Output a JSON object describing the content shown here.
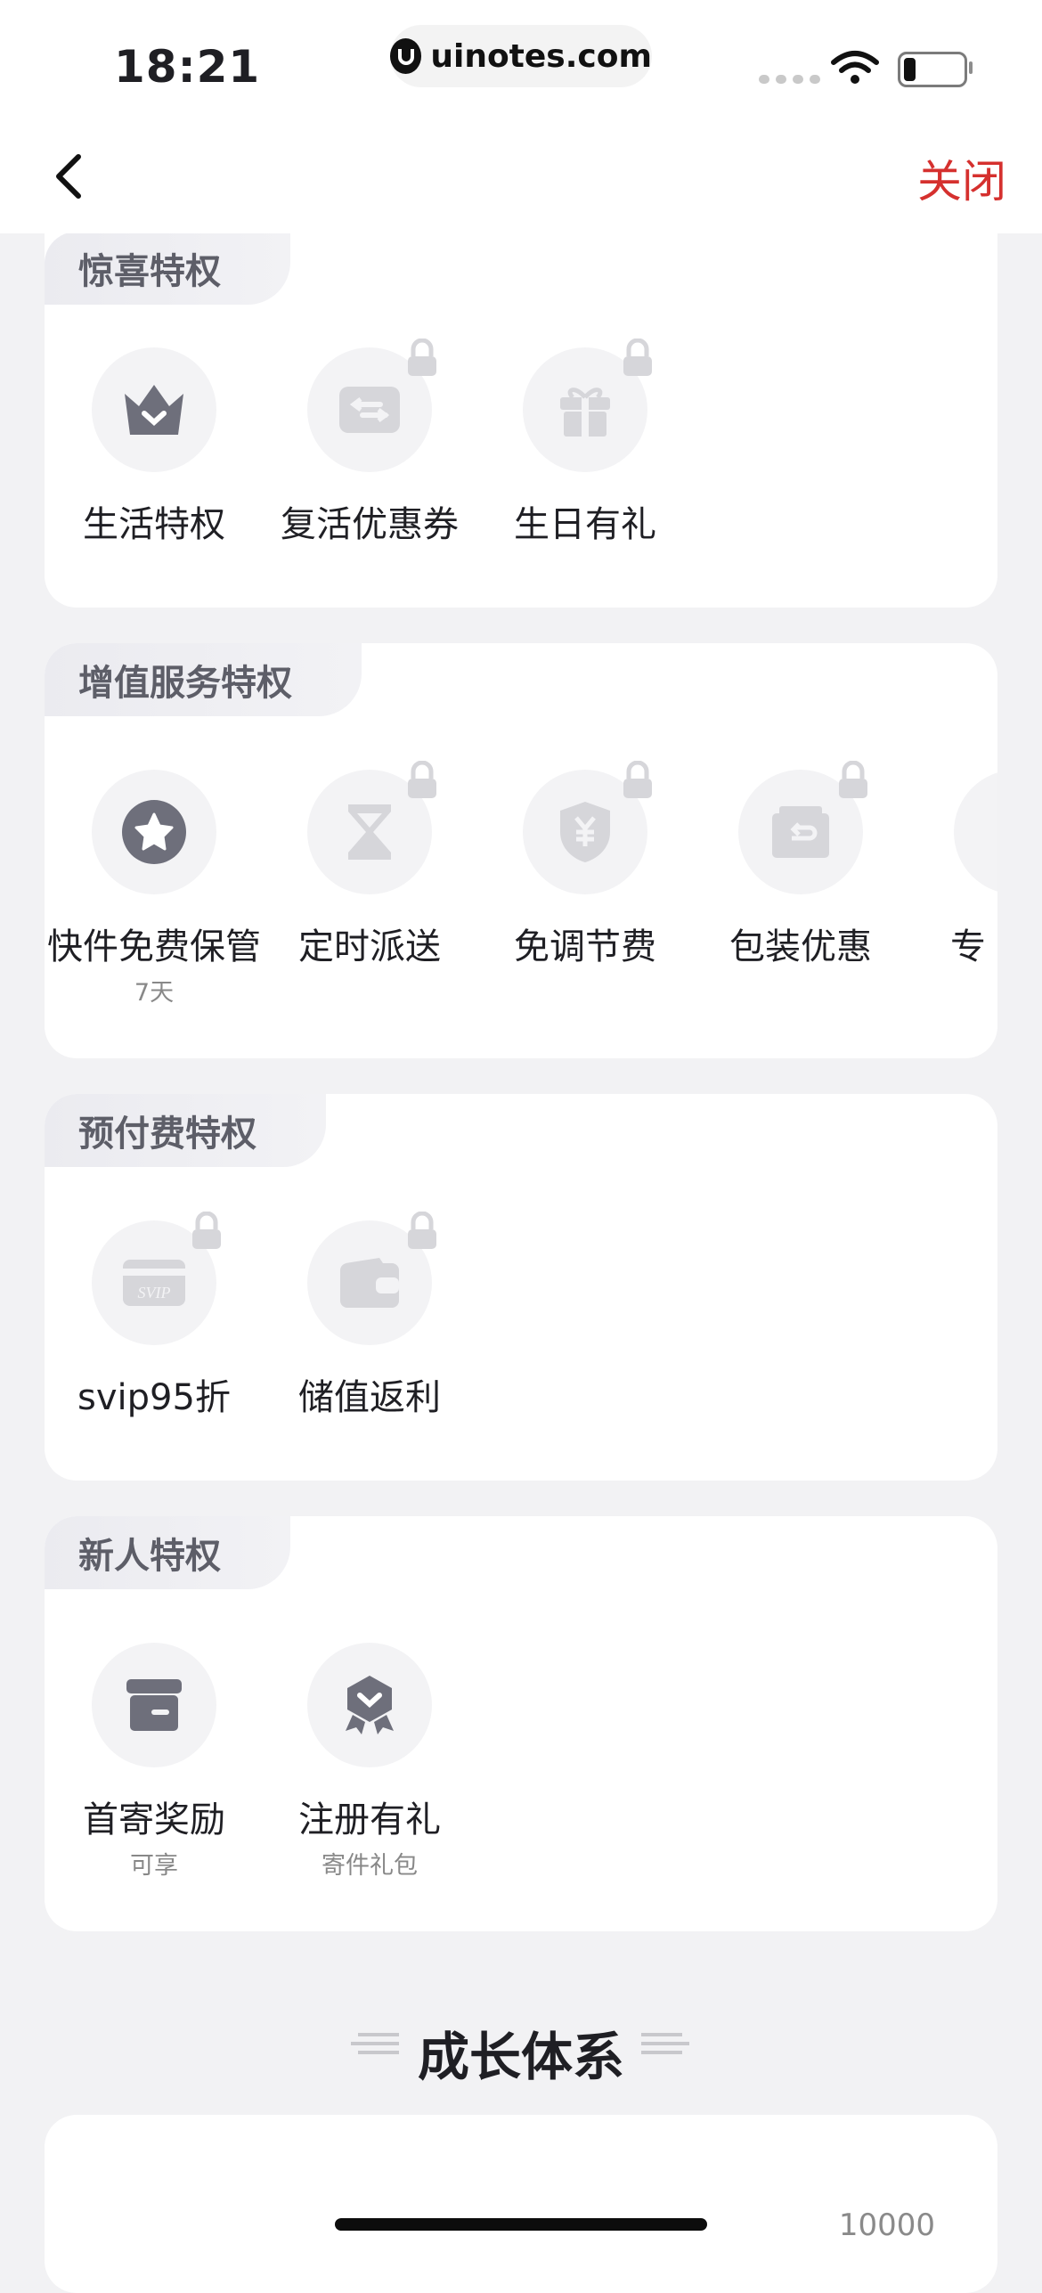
{
  "status_bar": {
    "time": "18:21",
    "url": "uinotes.com"
  },
  "nav": {
    "close_label": "关闭"
  },
  "sections": [
    {
      "title": "惊喜特权",
      "items": [
        {
          "label": "生活特权",
          "icon": "crown-icon",
          "locked": false
        },
        {
          "label": "复活优惠券",
          "icon": "coupon-icon",
          "locked": true
        },
        {
          "label": "生日有礼",
          "icon": "gift-icon",
          "locked": true
        }
      ]
    },
    {
      "title": "增值服务特权",
      "items": [
        {
          "label": "快件免费保管",
          "sub": "7天",
          "icon": "star-badge-icon",
          "locked": false
        },
        {
          "label": "定时派送",
          "icon": "hourglass-icon",
          "locked": true
        },
        {
          "label": "免调节费",
          "icon": "yuan-shield-icon",
          "locked": true
        },
        {
          "label": "包装优惠",
          "icon": "package-return-icon",
          "locked": true
        },
        {
          "label": "专",
          "icon": "partial-icon",
          "locked": false
        }
      ]
    },
    {
      "title": "预付费特权",
      "items": [
        {
          "label": "svip95折",
          "icon": "svip-card-icon",
          "locked": true
        },
        {
          "label": "储值返利",
          "icon": "wallet-icon",
          "locked": true
        }
      ]
    },
    {
      "title": "新人特权",
      "items": [
        {
          "label": "首寄奖励",
          "sub": "可享",
          "icon": "box-icon",
          "locked": false
        },
        {
          "label": "注册有礼",
          "sub": "寄件礼包",
          "icon": "medal-icon",
          "locked": false
        }
      ]
    }
  ],
  "growth": {
    "title": "成长体系",
    "max_value": "10000"
  },
  "colors": {
    "accent": "#d5302e",
    "active_icon": "#6e6f7b",
    "locked_icon": "#d6d6da"
  }
}
